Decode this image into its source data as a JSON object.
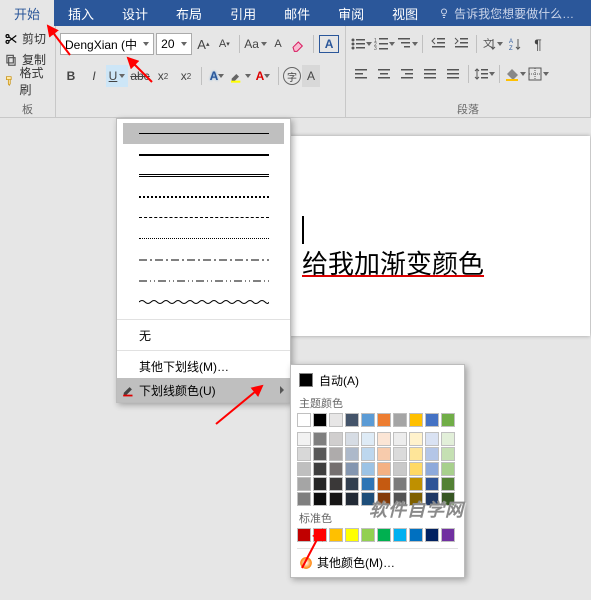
{
  "tabs": {
    "start": "开始",
    "insert": "插入",
    "design": "设计",
    "layout": "布局",
    "reference": "引用",
    "mail": "邮件",
    "review": "审阅",
    "view": "视图"
  },
  "tellme": "告诉我您想要做什么…",
  "clipboard": {
    "cut": "剪切",
    "copy": "复制",
    "formatpainter": "格式刷",
    "group_label": "板"
  },
  "font": {
    "name": "DengXian (中",
    "size": "20"
  },
  "paragraph": {
    "group_label": "段落"
  },
  "document": {
    "text": "给我加渐变颜色"
  },
  "underline_menu": {
    "none": "无",
    "more_lines": "其他下划线(M)…",
    "color": "下划线颜色(U)"
  },
  "color_popup": {
    "auto": "自动(A)",
    "theme": "主题颜色",
    "standard": "标准色",
    "more": "其他颜色(M)…",
    "theme_row1": [
      "#ffffff",
      "#000000",
      "#e7e6e6",
      "#44546a",
      "#5b9bd5",
      "#ed7d31",
      "#a5a5a5",
      "#ffc000",
      "#4472c4",
      "#70ad47"
    ],
    "theme_shades": [
      [
        "#f2f2f2",
        "#7f7f7f",
        "#d0cece",
        "#d6dce4",
        "#deebf6",
        "#fbe5d5",
        "#ededed",
        "#fff2cc",
        "#d9e2f3",
        "#e2efd9"
      ],
      [
        "#d8d8d8",
        "#595959",
        "#aeabab",
        "#adb9ca",
        "#bdd7ee",
        "#f7cbac",
        "#dbdbdb",
        "#fee599",
        "#b4c6e7",
        "#c5e0b3"
      ],
      [
        "#bfbfbf",
        "#3f3f3f",
        "#757070",
        "#8496b0",
        "#9cc3e5",
        "#f4b183",
        "#c9c9c9",
        "#ffd965",
        "#8eaadb",
        "#a8d08d"
      ],
      [
        "#a5a5a5",
        "#262626",
        "#3a3838",
        "#323f4f",
        "#2e75b5",
        "#c55a11",
        "#7b7b7b",
        "#bf9000",
        "#2f5496",
        "#538135"
      ],
      [
        "#7f7f7f",
        "#0c0c0c",
        "#171616",
        "#222a35",
        "#1e4e79",
        "#833c0b",
        "#525252",
        "#7f6000",
        "#1f3864",
        "#375623"
      ]
    ],
    "standard_row": [
      "#c00000",
      "#ff0000",
      "#ffc000",
      "#ffff00",
      "#92d050",
      "#00b050",
      "#00b0f0",
      "#0070c0",
      "#002060",
      "#7030a0"
    ]
  },
  "watermark": "软件自学网"
}
